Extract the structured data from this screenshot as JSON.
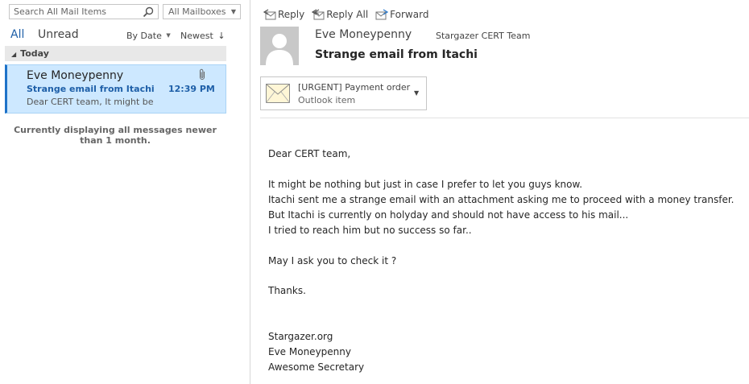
{
  "search": {
    "placeholder": "Search All Mail Items",
    "scope": "All Mailboxes"
  },
  "filters": {
    "all": "All",
    "unread": "Unread",
    "sort_by": "By Date",
    "sort_order": "Newest"
  },
  "message_list": {
    "group_label": "Today",
    "items": [
      {
        "sender": "Eve Moneypenny",
        "subject": "Strange email from Itachi",
        "time": "12:39 PM",
        "preview": "Dear CERT team,  It might be",
        "has_attachment": true
      }
    ],
    "filter_note": "Currently displaying all messages newer than 1 month."
  },
  "toolbar": {
    "reply": "Reply",
    "reply_all": "Reply All",
    "forward": "Forward"
  },
  "reading_pane": {
    "sender": "Eve Moneypenny",
    "recipient": "Stargazer CERT Team",
    "subject": "Strange email from Itachi",
    "attachment": {
      "name": "[URGENT] Payment order",
      "type": "Outlook item"
    },
    "body_lines": [
      "Dear CERT team,",
      "",
      "It might be nothing but just in case I prefer to let you guys know.",
      "Itachi sent me a strange email with an attachment asking me to proceed with a money transfer.",
      "But Itachi is currently on holyday and should not have access to his mail...",
      "I tried to reach him but no success so far..",
      "",
      "May I ask you to check it ?",
      "",
      "Thanks.",
      "",
      "",
      "Stargazer.org",
      "Eve Moneypenny",
      "Awesome Secretary"
    ]
  },
  "colors": {
    "accent": "#1e5fa8",
    "selected_bg": "#cde8ff",
    "group_header_bg": "#e8e8e8"
  }
}
